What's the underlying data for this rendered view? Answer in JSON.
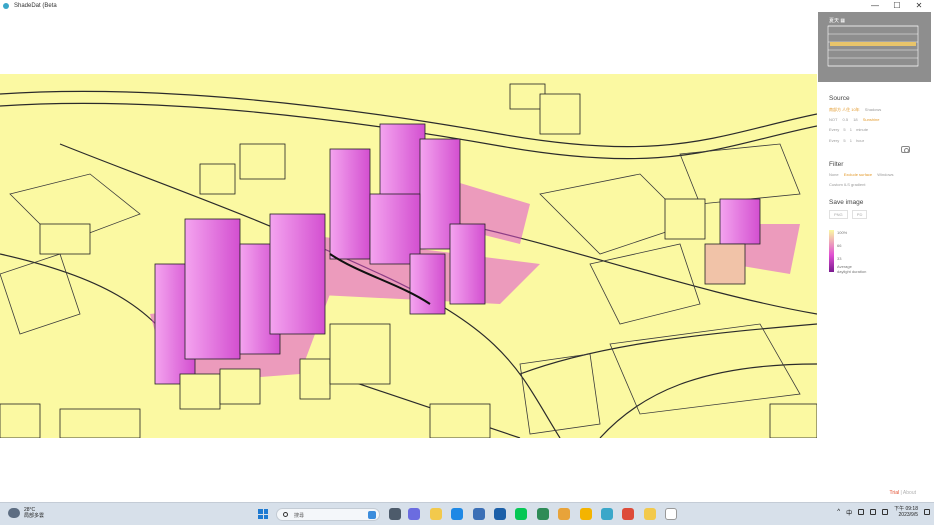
{
  "app": {
    "title": "ShadeDat (Beta"
  },
  "window_controls": {
    "minimize": "—",
    "maximize": "☐",
    "close": "✕"
  },
  "panel": {
    "minimap_header": "夏天 ▦",
    "source": {
      "title": "Source",
      "row1": [
        "南部方 人住 10年",
        "Shadows"
      ],
      "row2": [
        "NOT",
        "0.5",
        "18",
        "Sunshine"
      ],
      "row3": [
        "Every",
        "5",
        "1",
        "minute"
      ],
      "row4": [
        "Every",
        "5",
        "1",
        "hour"
      ]
    },
    "filter": {
      "title": "Filter",
      "row1": [
        "None",
        "Exclude surface",
        "Windows"
      ],
      "row2": "Custom ILS gradient"
    },
    "save_image": {
      "title": "Save image",
      "buttons": [
        "PNG",
        "PD"
      ]
    },
    "legend": {
      "top": "100%",
      "mid": "66",
      "low": "33",
      "caption1": "Average",
      "caption2": "daylight duration"
    },
    "trial": {
      "label": "Trial",
      "sep": "|",
      "extra": "About"
    }
  },
  "taskbar": {
    "weather_temp": "28°C",
    "weather_desc": "局部多雲",
    "search_placeholder": "搜尋",
    "time": "下午 09:18",
    "date": "2023/9/5",
    "language": "中"
  },
  "colors": {
    "base": "#fbf9a2",
    "shadow": "#e04fd2",
    "deep": "#7a1a8f",
    "taskbar": "#d7e0ea"
  }
}
